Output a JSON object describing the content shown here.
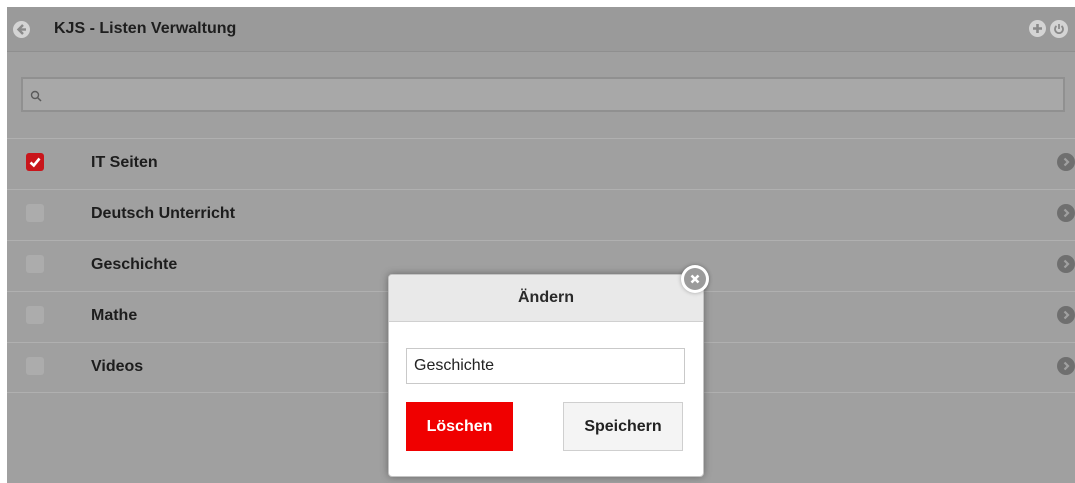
{
  "header": {
    "title": "KJS - Listen Verwaltung",
    "back_icon": "back-arrow-icon",
    "add_icon": "plus-circle-icon",
    "power_icon": "power-icon"
  },
  "search": {
    "icon": "search-icon",
    "value": ""
  },
  "list": {
    "items": [
      {
        "label": "IT Seiten",
        "checked": true
      },
      {
        "label": "Deutsch Unterricht",
        "checked": false
      },
      {
        "label": "Geschichte",
        "checked": false
      },
      {
        "label": "Mathe",
        "checked": false
      },
      {
        "label": "Videos",
        "checked": false
      }
    ]
  },
  "modal": {
    "title": "Ändern",
    "input_value": "Geschichte",
    "delete_label": "Löschen",
    "save_label": "Speichern",
    "close_icon": "close-icon"
  },
  "colors": {
    "accent_red": "#f00000",
    "checkbox_checked": "#c9151b"
  }
}
